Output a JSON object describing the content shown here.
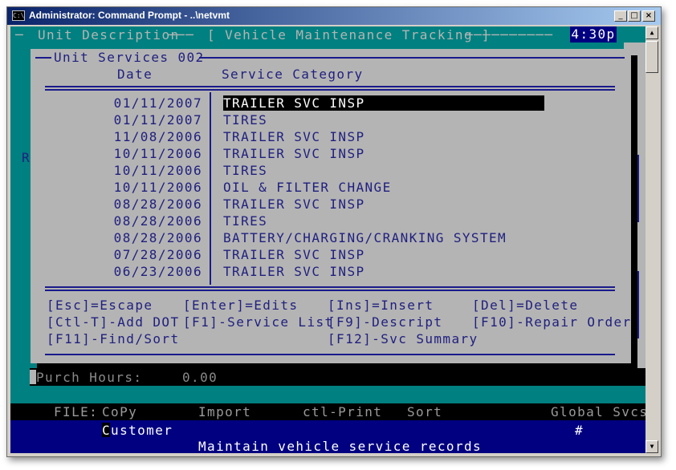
{
  "window": {
    "title": "Administrator: Command Prompt - ..\\netvmt",
    "icon_text": "C:\\"
  },
  "screen": {
    "header_left": "Unit Description",
    "header_title": "[ Vehicle Maintenance Tracking ]",
    "clock": "4:30p",
    "side_letter": "R",
    "purch_hours_label": "Purch Hours:",
    "purch_hours_value": "0.00"
  },
  "popup": {
    "title": "Unit Services 002",
    "col_date": "Date",
    "col_category": "Service Category",
    "rows": [
      {
        "date": "01/11/2007",
        "category": "TRAILER SVC INSP",
        "selected": true
      },
      {
        "date": "01/11/2007",
        "category": "TIRES"
      },
      {
        "date": "11/08/2006",
        "category": "TRAILER SVC INSP"
      },
      {
        "date": "10/11/2006",
        "category": "TRAILER SVC INSP"
      },
      {
        "date": "10/11/2006",
        "category": "TIRES"
      },
      {
        "date": "10/11/2006",
        "category": "OIL & FILTER CHANGE"
      },
      {
        "date": "08/28/2006",
        "category": "TRAILER SVC INSP"
      },
      {
        "date": "08/28/2006",
        "category": "TIRES"
      },
      {
        "date": "08/28/2006",
        "category": "BATTERY/CHARGING/CRANKING SYSTEM"
      },
      {
        "date": "07/28/2006",
        "category": "TRAILER SVC INSP"
      },
      {
        "date": "06/23/2006",
        "category": "TRAILER SVC INSP"
      }
    ],
    "keys": {
      "esc": "[Esc]=Escape",
      "enter": "[Enter]=Edits",
      "ins": "[Ins]=Insert",
      "del": "[Del]=Delete",
      "ctlt": "[Ctl-T]-Add DOT",
      "f1": "[F1]-Service List",
      "f9": "[F9]-Descript",
      "f10": "[F10]-Repair Order",
      "f11": "[F11]-Find/Sort",
      "f12": "[F12]-Svc Summary"
    }
  },
  "menu": {
    "file": "FILE:",
    "copy": "CoPy",
    "import": "Import",
    "print": "ctl-Print",
    "sort": "Sort",
    "global": "Global Svcs"
  },
  "footer": {
    "customer": "Customer",
    "hash": "#",
    "status": "Maintain vehicle service records"
  },
  "colors": {
    "console_bg": "#008080",
    "panel_gray": "#b4b4b4",
    "text_blue": "#202080",
    "status_bar": "#000080"
  }
}
